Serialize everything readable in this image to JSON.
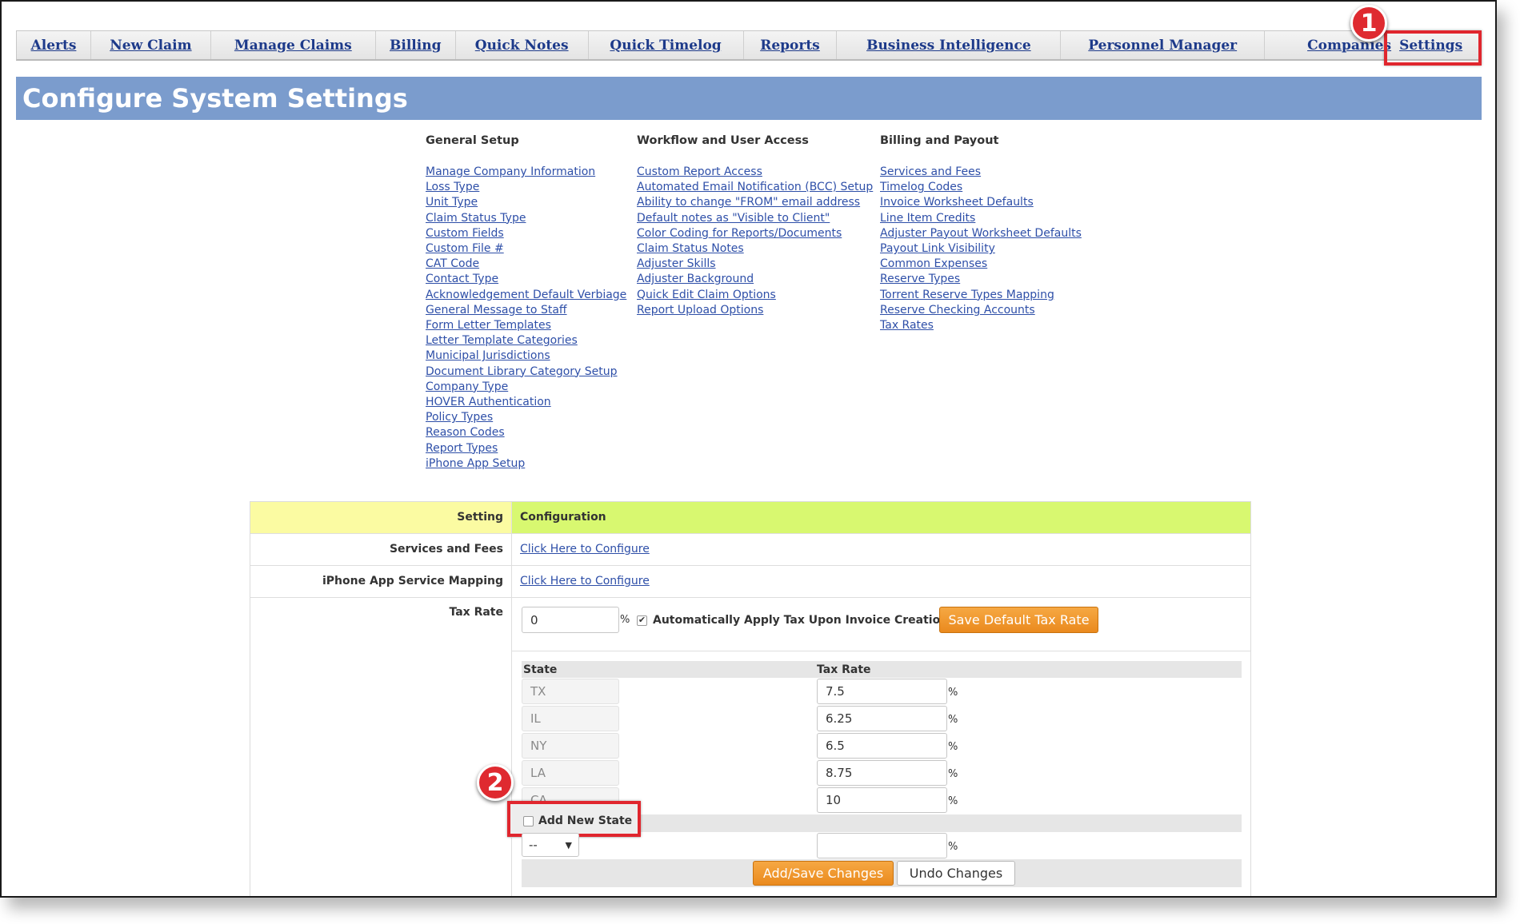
{
  "nav": {
    "items": [
      {
        "label": "Alerts"
      },
      {
        "label": "New Claim"
      },
      {
        "label": "Manage Claims"
      },
      {
        "label": "Billing"
      },
      {
        "label": "Quick Notes"
      },
      {
        "label": "Quick Timelog"
      },
      {
        "label": "Reports"
      },
      {
        "label": "Business Intelligence"
      },
      {
        "label": "Personnel Manager"
      },
      {
        "label": "Companies"
      },
      {
        "label": "Settings"
      }
    ]
  },
  "annotations": {
    "badge_1": "1",
    "badge_2": "2",
    "color": "#e0262e"
  },
  "page_title": "Configure System Settings",
  "columns": {
    "general_setup": {
      "heading": "General Setup",
      "links": [
        "Manage Company Information",
        "Loss Type",
        "Unit Type",
        "Claim Status Type",
        "Custom Fields",
        "Custom File #",
        "CAT Code",
        "Contact Type",
        "Acknowledgement Default Verbiage",
        "General Message to Staff",
        "Form Letter Templates",
        "Letter Template Categories",
        "Municipal Jurisdictions",
        "Document Library Category Setup",
        "Company Type",
        "HOVER Authentication",
        "Policy Types",
        "Reason Codes",
        "Report Types",
        "iPhone App Setup"
      ]
    },
    "workflow": {
      "heading": "Workflow and User Access",
      "links": [
        "Custom Report Access",
        "Automated Email Notification (BCC) Setup",
        "Ability to change \"FROM\" email address",
        "Default notes as \"Visible to Client\"",
        "Color Coding for Reports/Documents",
        "Claim Status Notes",
        "Adjuster Skills",
        "Adjuster Background",
        "Quick Edit Claim Options",
        "Report Upload Options"
      ]
    },
    "billing": {
      "heading": "Billing and Payout",
      "links": [
        "Services and Fees",
        "Timelog Codes",
        "Invoice Worksheet Defaults",
        "Line Item Credits",
        "Adjuster Payout Worksheet Defaults",
        "Payout Link Visibility",
        "Common Expenses",
        "Reserve Types",
        "Torrent Reserve Types Mapping",
        "Reserve Checking Accounts",
        "Tax Rates"
      ]
    }
  },
  "table": {
    "header_setting": "Setting",
    "header_config": "Configuration",
    "rows": [
      {
        "label": "Services and Fees",
        "value": "Click Here to Configure"
      },
      {
        "label": "iPhone App Service Mapping",
        "value": "Click Here to Configure"
      }
    ],
    "tax": {
      "label": "Tax Rate",
      "default_value": "0",
      "percent": "%",
      "auto_apply_label": "Automatically Apply Tax Upon Invoice Creation",
      "auto_apply_checked": "✔",
      "save_button": "Save Default Tax Rate",
      "col_state": "State",
      "col_rate": "Tax Rate",
      "states": [
        {
          "state": "TX",
          "rate": "7.5"
        },
        {
          "state": "IL",
          "rate": "6.25"
        },
        {
          "state": "NY",
          "rate": "6.5"
        },
        {
          "state": "LA",
          "rate": "8.75"
        },
        {
          "state": "CA",
          "rate": "10"
        }
      ],
      "add_new_state_label": "Add New State",
      "new_state_select": "--",
      "new_rate_value": "",
      "add_save_button": "Add/Save Changes",
      "undo_button": "Undo Changes"
    }
  }
}
